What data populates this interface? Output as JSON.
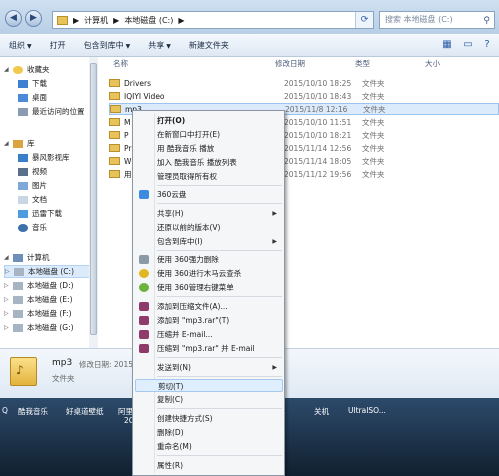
{
  "address": {
    "segments": [
      "计算机",
      "本地磁盘 (C:)"
    ],
    "search_placeholder": "搜索 本地磁盘 (C:)"
  },
  "toolbar": {
    "organize": "组织",
    "open": "打开",
    "include_in_library": "包含到库中",
    "share": "共享",
    "new_folder": "新建文件夹"
  },
  "sidebar": {
    "favorites_title": "收藏夹",
    "favorites": [
      "下载",
      "桌面",
      "最近访问的位置"
    ],
    "libraries_title": "库",
    "libraries": [
      "暴风影视库",
      "视频",
      "图片",
      "文档",
      "迅雷下载",
      "音乐"
    ],
    "computer_title": "计算机",
    "drives": [
      "本地磁盘 (C:)",
      "本地磁盘 (D:)",
      "本地磁盘 (E:)",
      "本地磁盘 (F:)",
      "本地磁盘 (G:)"
    ],
    "network_title": "网络"
  },
  "columns": {
    "name": "名称",
    "modified": "修改日期",
    "type": "类型",
    "size": "大小"
  },
  "files": [
    {
      "name": "Drivers",
      "date": "2015/10/10 18:25",
      "type": "文件夹"
    },
    {
      "name": "IQIYI Video",
      "date": "2015/10/10 18:43",
      "type": "文件夹"
    },
    {
      "name": "mp3",
      "date": "2015/11/8 12:16",
      "type": "文件夹"
    },
    {
      "name": "M",
      "date": "2015/10/10 11:51",
      "type": "文件夹"
    },
    {
      "name": "P",
      "date": "2015/10/10 18:21",
      "type": "文件夹"
    },
    {
      "name": "Pr",
      "date": "2015/11/14 12:56",
      "type": "文件夹"
    },
    {
      "name": "W",
      "date": "2015/11/14 18:05",
      "type": "文件夹"
    },
    {
      "name": "用",
      "date": "2015/11/12 19:56",
      "type": "文件夹"
    }
  ],
  "details": {
    "name": "mp3",
    "meta": "修改日期: 2015/1",
    "type": "文件夹"
  },
  "taskbar": [
    "Q",
    "酷我音乐",
    "好桌道壁纸",
    "阿里",
    "2C",
    "关机",
    "UltraISO..."
  ],
  "context_menu": {
    "open": "打开(O)",
    "open_new_window": "在新窗口中打开(E)",
    "play_kuwo": "用 酷我音乐 播放",
    "add_kuwo_list": "加入 酷我音乐 播放列表",
    "admin_ownership": "管理员取得所有权",
    "yun360": "360云盘",
    "share": "共享(H)",
    "restore_versions": "还原以前的版本(V)",
    "include_library": "包含到库中(I)",
    "force_delete_360": "使用 360强力删除",
    "trojan_scan_360": "使用 360进行木马云查杀",
    "menu_manage_360": "使用 360管理右键菜单",
    "add_archive": "添加到压缩文件(A)...",
    "add_to_rar": "添加到 \"mp3.rar\"(T)",
    "compress_email": "压缩并 E-mail...",
    "compress_rar_email": "压缩到 \"mp3.rar\" 并 E-mail",
    "send_to": "发送到(N)",
    "cut": "剪切(T)",
    "copy": "复制(C)",
    "create_shortcut": "创建快捷方式(S)",
    "delete": "删除(D)",
    "rename": "重命名(M)",
    "properties": "属性(R)"
  },
  "colors": {
    "accent": "#2a5ba8",
    "folder": "#e8c35a",
    "selection": "#dcebfc",
    "menu_bg": "#f4f6f8",
    "taskbar": "#1b3048"
  }
}
